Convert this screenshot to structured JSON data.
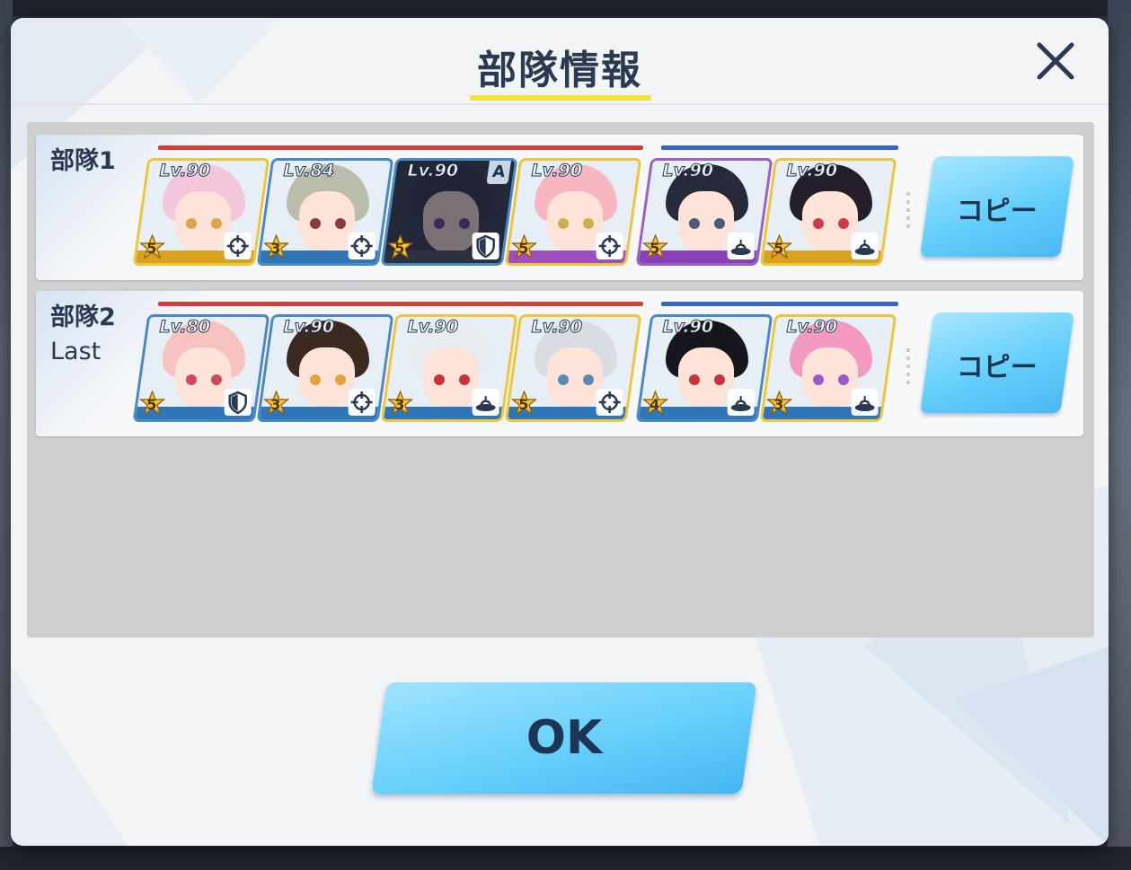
{
  "dialog": {
    "title": "部隊情報",
    "ok_label": "OK",
    "close_icon": "close-icon"
  },
  "colors": {
    "striker_bar": "#c8443c",
    "special_bar": "#3a68c0",
    "button_blue": "#64cffb",
    "title_underline": "#f5e33a"
  },
  "teams": [
    {
      "name": "部隊1",
      "subtitle": "",
      "copy_label": "コピー",
      "students": [
        {
          "level": "Lv.90",
          "stars": "5",
          "role_icon": "crosshair-icon",
          "hair": "#f4c6da",
          "eye": "#d9a64a",
          "frame": "gold",
          "footer": "#d9a21e"
        },
        {
          "level": "Lv.84",
          "stars": "3",
          "role_icon": "crosshair-icon",
          "hair": "#b9bda9",
          "eye": "#8a3a3a",
          "frame": "blue",
          "footer": "#2f76b8"
        },
        {
          "level": "Lv.90",
          "stars": "5",
          "role_icon": "shield-icon",
          "hair": "#3a3550",
          "eye": "#6a4a9a",
          "frame": "dim",
          "footer": "#2b3140",
          "assist": "A"
        },
        {
          "level": "Lv.90",
          "stars": "5",
          "role_icon": "crosshair-icon",
          "hair": "#f6b7c0",
          "eye": "#c9b24a",
          "frame": "gold",
          "footer": "#9d4fc0"
        },
        {
          "level": "Lv.90",
          "stars": "5",
          "role_icon": "support-icon",
          "hair": "#262a3a",
          "eye": "#4a5a7a",
          "frame": "purple",
          "footer": "#8a40b8"
        },
        {
          "level": "Lv.90",
          "stars": "5",
          "role_icon": "support-icon",
          "hair": "#241e28",
          "eye": "#d23a4a",
          "frame": "gold",
          "footer": "#d9a21e"
        }
      ]
    },
    {
      "name": "部隊2",
      "subtitle": "Last",
      "copy_label": "コピー",
      "students": [
        {
          "level": "Lv.80",
          "stars": "5",
          "role_icon": "shield-icon",
          "hair": "#f7c2bf",
          "eye": "#d24a5a",
          "frame": "blue",
          "footer": "#2f76b8"
        },
        {
          "level": "Lv.90",
          "stars": "3",
          "role_icon": "crosshair-icon",
          "hair": "#3b2a20",
          "eye": "#e0a43a",
          "frame": "blue",
          "footer": "#2f76b8"
        },
        {
          "level": "Lv.90",
          "stars": "3",
          "role_icon": "support-icon",
          "hair": "#e9ecef",
          "eye": "#c8323a",
          "frame": "gold",
          "footer": "#2f76b8"
        },
        {
          "level": "Lv.90",
          "stars": "5",
          "role_icon": "crosshair-icon",
          "hair": "#d9dde2",
          "eye": "#5a8ab8",
          "frame": "gold",
          "footer": "#2f76b8"
        },
        {
          "level": "Lv.90",
          "stars": "4",
          "role_icon": "support-icon",
          "hair": "#16161c",
          "eye": "#c8323a",
          "frame": "blue",
          "footer": "#2f76b8"
        },
        {
          "level": "Lv.90",
          "stars": "3",
          "role_icon": "support-icon",
          "hair": "#f29ac0",
          "eye": "#9a5ac8",
          "frame": "gold",
          "footer": "#2f76b8"
        }
      ]
    }
  ]
}
